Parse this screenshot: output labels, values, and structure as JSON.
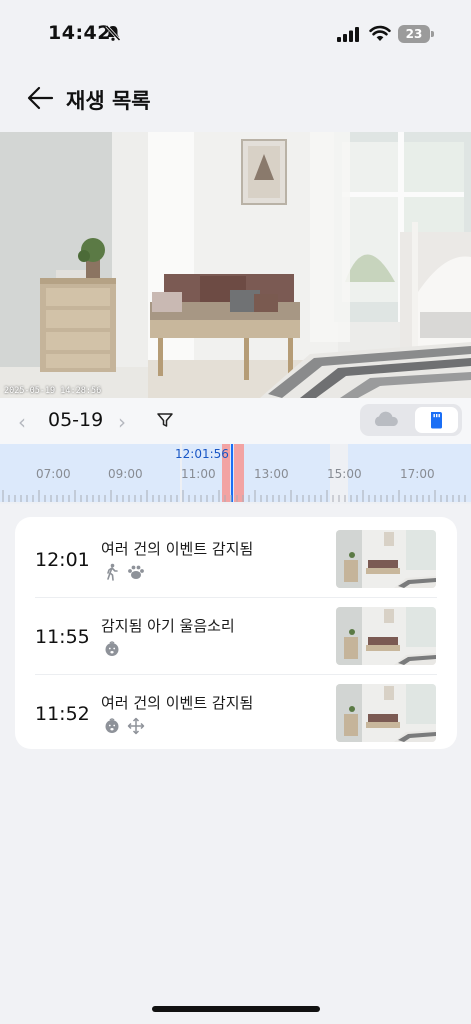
{
  "status_bar": {
    "time": "14:42",
    "battery": "23"
  },
  "header": {
    "title": "재생 목록"
  },
  "video": {
    "timestamp": "2025-05-19  14:28:56"
  },
  "date_bar": {
    "prev": "‹",
    "date": "05-19",
    "next": "›"
  },
  "timeline": {
    "current_time": "12:01:56",
    "labels": [
      "07:00",
      "09:00",
      "11:00",
      "13:00",
      "15:00",
      "17:00"
    ]
  },
  "events": [
    {
      "time": "12:01",
      "title": "여러 건의 이벤트 감지됨",
      "icons": [
        "person-motion-icon",
        "pet-paw-icon"
      ]
    },
    {
      "time": "11:55",
      "title": "감지됨 아기 울음소리",
      "icons": [
        "baby-cry-icon"
      ]
    },
    {
      "time": "11:52",
      "title": "여러 건의 이벤트 감지됨",
      "icons": [
        "baby-cry-icon",
        "motion-move-icon"
      ]
    }
  ],
  "colors": {
    "accent": "#1a6ef5",
    "timeline_band": "#dce9fb",
    "event_mark": "#f2a3a3"
  }
}
